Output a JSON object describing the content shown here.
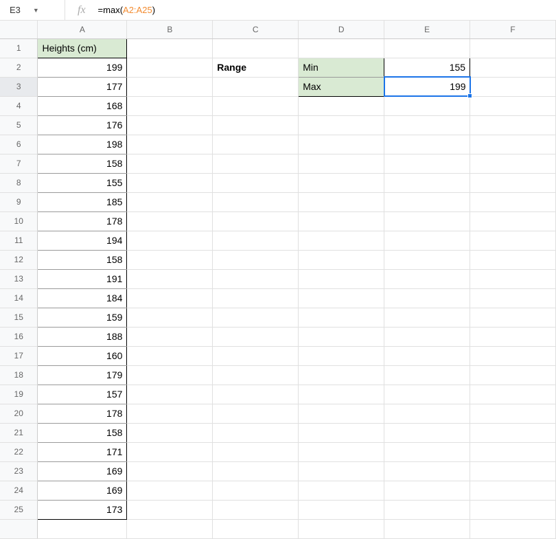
{
  "nameBox": "E3",
  "formula": {
    "prefix": "=max(",
    "range": "A2:A25",
    "suffix": ")"
  },
  "columns": [
    "A",
    "B",
    "C",
    "D",
    "E",
    "F"
  ],
  "rowCount": 26,
  "cells": {
    "A1": "Heights (cm)",
    "A2": "199",
    "A3": "177",
    "A4": "168",
    "A5": "176",
    "A6": "198",
    "A7": "158",
    "A8": "155",
    "A9": "185",
    "A10": "178",
    "A11": "194",
    "A12": "158",
    "A13": "191",
    "A14": "184",
    "A15": "159",
    "A16": "188",
    "A17": "160",
    "A18": "179",
    "A19": "157",
    "A20": "178",
    "A21": "158",
    "A22": "171",
    "A23": "169",
    "A24": "169",
    "A25": "173",
    "C2": "Range",
    "D2": "Min",
    "D3": "Max",
    "E2": "155",
    "E3": "199"
  },
  "selectedCell": "E3",
  "activeRow": 3
}
